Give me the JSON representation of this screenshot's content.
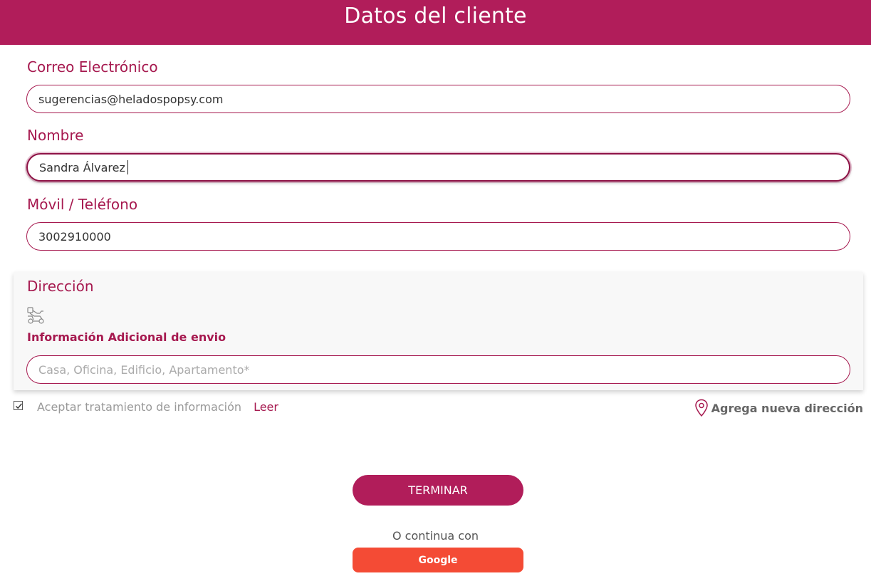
{
  "header": {
    "title": "Datos del cliente"
  },
  "form": {
    "email": {
      "label": "Correo Electrónico",
      "value": "sugerencias@heladospopsy.com"
    },
    "name": {
      "label": "Nombre",
      "value": "Sandra Álvarez"
    },
    "phone": {
      "label": "Móvil / Teléfono",
      "value": "3002910000"
    }
  },
  "address": {
    "label": "Dirección",
    "icon": "delivery-scooter-icon",
    "extra_title": "Información Adicional de envio",
    "extra_placeholder": "Casa, Oficina, Edificio, Apartamento*"
  },
  "consent": {
    "checked": true,
    "text": "Aceptar tratamiento de información",
    "link": "Leer"
  },
  "add_address": {
    "icon": "location-pin-icon",
    "label": "Agrega nueva dirección"
  },
  "actions": {
    "submit_label": "TERMINAR",
    "continue_text": "O continua con",
    "google_label": "Google"
  },
  "colors": {
    "brand": "#b11d5a",
    "google": "#f44b35"
  }
}
